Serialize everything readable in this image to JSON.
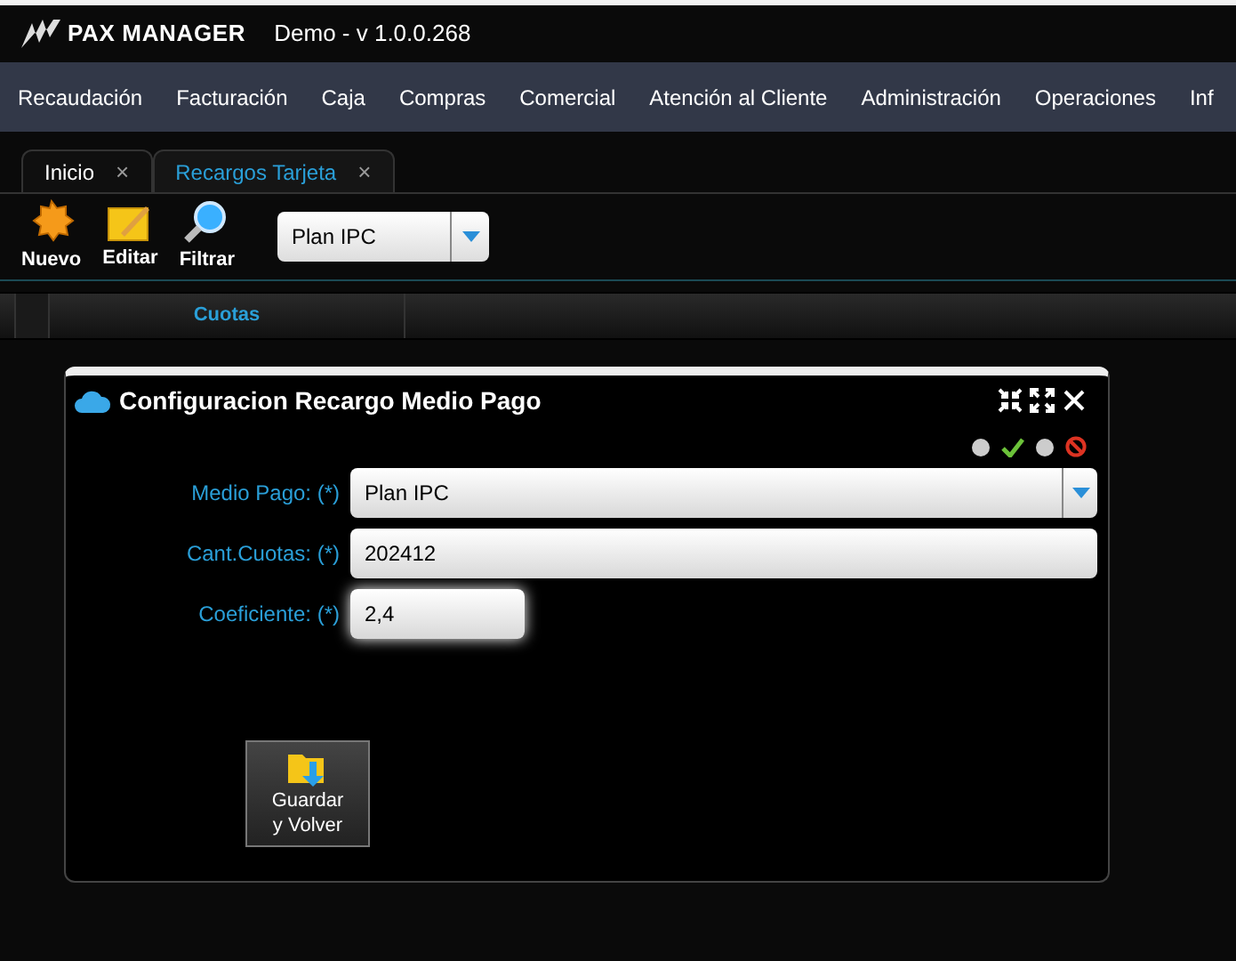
{
  "app": {
    "brand": "PAX MANAGER",
    "version": "Demo - v 1.0.0.268"
  },
  "menu": [
    "Recaudación",
    "Facturación",
    "Caja",
    "Compras",
    "Comercial",
    "Atención al Cliente",
    "Administración",
    "Operaciones",
    "Inf"
  ],
  "tabs": [
    {
      "label": "Inicio",
      "selected": false,
      "close": "×"
    },
    {
      "label": "Recargos Tarjeta",
      "selected": true,
      "close": "×"
    }
  ],
  "toolbar": {
    "buttons": [
      {
        "kind": "new",
        "label": "Nuevo"
      },
      {
        "kind": "edit",
        "label": "Editar"
      },
      {
        "kind": "filter",
        "label": "Filtrar"
      }
    ],
    "select": "Plan IPC"
  },
  "grid": {
    "columns": [
      "Cuotas"
    ]
  },
  "dialog": {
    "title": "Configuracion Recargo Medio Pago",
    "fields": [
      {
        "kind": "select",
        "label": "Medio Pago: (*)",
        "value": "Plan IPC"
      },
      {
        "kind": "text",
        "label": "Cant.Cuotas: (*)",
        "value": "202412"
      },
      {
        "kind": "short",
        "label": "Coeficiente: (*)",
        "value": "2,4"
      }
    ],
    "save_button": [
      "Guardar",
      "y Volver"
    ]
  }
}
